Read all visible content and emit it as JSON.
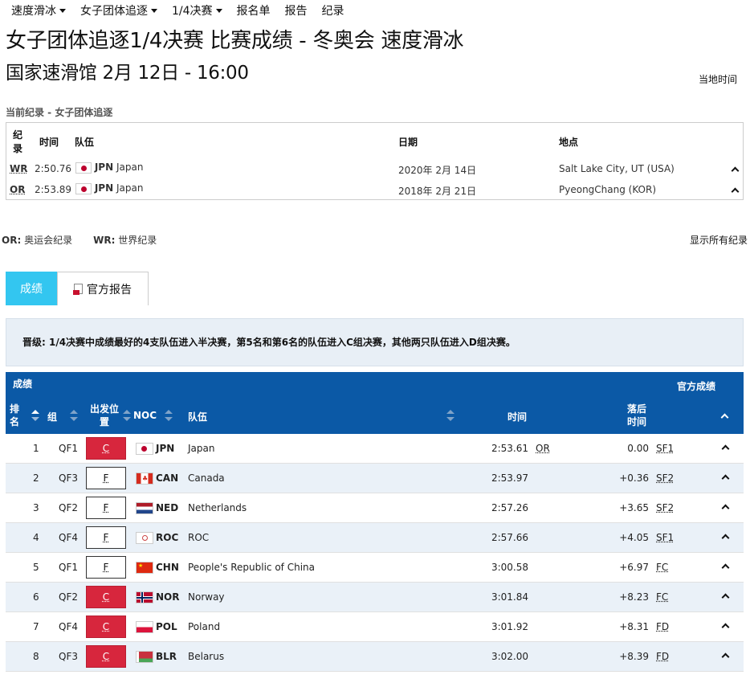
{
  "nav": {
    "items": [
      {
        "label": "速度滑冰",
        "dropdown": true
      },
      {
        "label": "女子团体追逐",
        "dropdown": true
      },
      {
        "label": "1/4决赛",
        "dropdown": true
      },
      {
        "label": "报名单",
        "dropdown": false
      },
      {
        "label": "报告",
        "dropdown": false
      },
      {
        "label": "纪录",
        "dropdown": false
      }
    ]
  },
  "page": {
    "title": "女子团体追逐1/4决赛 比赛成绩 - 冬奥会 速度滑冰",
    "subtitle": "国家速滑馆 2月 12日 - 16:00",
    "local_time": "当地时间"
  },
  "records": {
    "heading": "当前纪录 - 女子团体追逐",
    "headers": {
      "record_line1": "纪",
      "record_line2": "录",
      "time": "时间",
      "team": "队伍",
      "date": "日期",
      "location": "地点"
    },
    "rows": [
      {
        "code": "WR",
        "time": "2:50.76",
        "noc": "JPN",
        "team": "Japan",
        "date": "2020年 2月 14日",
        "location": "Salt Lake City, UT (USA)"
      },
      {
        "code": "OR",
        "time": "2:53.89",
        "noc": "JPN",
        "team": "Japan",
        "date": "2018年 2月 21日",
        "location": "PyeongChang (KOR)"
      }
    ]
  },
  "legend": {
    "or_code": "OR:",
    "or_text": "奥运会纪录",
    "wr_code": "WR:",
    "wr_text": "世界纪录",
    "show_all": "显示所有纪录"
  },
  "tabs": {
    "results": "成绩",
    "report": "官方报告"
  },
  "info": {
    "text": "晋级: 1/4决赛中成绩最好的4支队伍进入半决赛，第5名和第6名的队伍进入C组决赛，其他两只队伍进入D组决赛。"
  },
  "results": {
    "section_label": "成绩",
    "official_label": "官方成绩",
    "headers": {
      "rank_line1": "排",
      "rank_line2": "名",
      "group": "组",
      "start_line1": "出发位",
      "start_line2": "置",
      "noc": "NOC",
      "team": "队伍",
      "time": "时间",
      "behind_line1": "落后",
      "behind_line2": "时间"
    },
    "rows": [
      {
        "rank": "1",
        "group": "QF1",
        "lane": "C",
        "lane_color": "#d7263d",
        "noc": "JPN",
        "team": "Japan",
        "time": "2:53.61",
        "record": "OR",
        "behind": "0.00",
        "qual": "SF1"
      },
      {
        "rank": "2",
        "group": "QF3",
        "lane": "F",
        "lane_color": "#ffffff",
        "noc": "CAN",
        "team": "Canada",
        "time": "2:53.97",
        "record": "",
        "behind": "+0.36",
        "qual": "SF2"
      },
      {
        "rank": "3",
        "group": "QF2",
        "lane": "F",
        "lane_color": "#ffffff",
        "noc": "NED",
        "team": "Netherlands",
        "time": "2:57.26",
        "record": "",
        "behind": "+3.65",
        "qual": "SF2"
      },
      {
        "rank": "4",
        "group": "QF4",
        "lane": "F",
        "lane_color": "#ffffff",
        "noc": "ROC",
        "team": "ROC",
        "time": "2:57.66",
        "record": "",
        "behind": "+4.05",
        "qual": "SF1"
      },
      {
        "rank": "5",
        "group": "QF1",
        "lane": "F",
        "lane_color": "#ffffff",
        "noc": "CHN",
        "team": "People's Republic of China",
        "time": "3:00.58",
        "record": "",
        "behind": "+6.97",
        "qual": "FC"
      },
      {
        "rank": "6",
        "group": "QF2",
        "lane": "C",
        "lane_color": "#d7263d",
        "noc": "NOR",
        "team": "Norway",
        "time": "3:01.84",
        "record": "",
        "behind": "+8.23",
        "qual": "FC"
      },
      {
        "rank": "7",
        "group": "QF4",
        "lane": "C",
        "lane_color": "#d7263d",
        "noc": "POL",
        "team": "Poland",
        "time": "3:01.92",
        "record": "",
        "behind": "+8.31",
        "qual": "FD"
      },
      {
        "rank": "8",
        "group": "QF3",
        "lane": "C",
        "lane_color": "#d7263d",
        "noc": "BLR",
        "team": "Belarus",
        "time": "3:02.00",
        "record": "",
        "behind": "+8.39",
        "qual": "FD"
      }
    ]
  },
  "colors": {
    "header_blue": "#0b59a6",
    "tab_active": "#33c6f0",
    "lane_red": "#d7263d",
    "row_alt": "#eaf1f8"
  }
}
